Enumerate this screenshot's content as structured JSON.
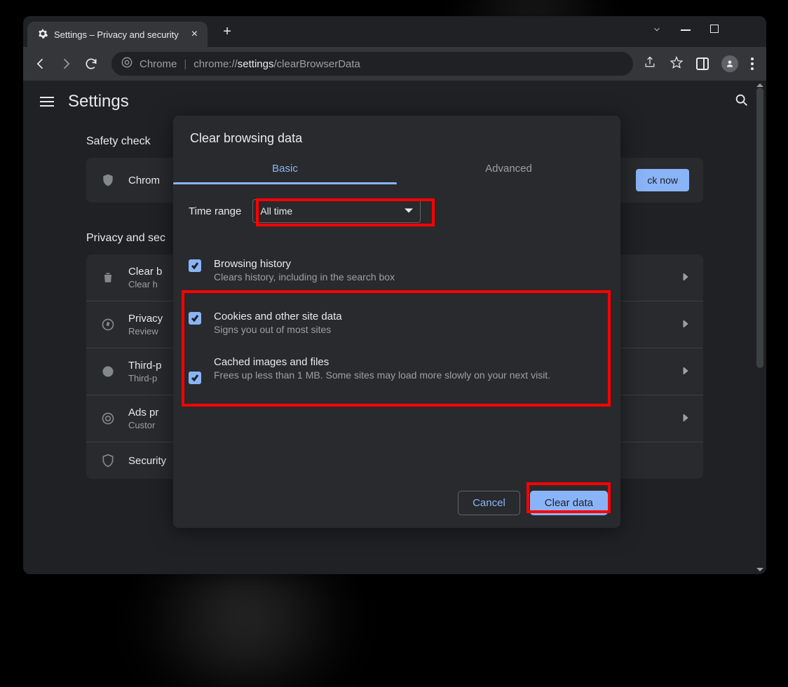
{
  "tab": {
    "title": "Settings – Privacy and security"
  },
  "omnibox": {
    "scheme_label": "Chrome",
    "url_prefix": "chrome://",
    "url_bold": "settings",
    "url_suffix": "/clearBrowserData"
  },
  "app": {
    "title": "Settings",
    "safety_check_heading": "Safety check",
    "safety_row_text": "Chrom",
    "check_now_label": "ck now",
    "privacy_heading": "Privacy and sec",
    "rows": [
      {
        "title": "Clear b",
        "sub": "Clear h"
      },
      {
        "title": "Privacy",
        "sub": "Review"
      },
      {
        "title": "Third-p",
        "sub": "Third-p"
      },
      {
        "title": "Ads pr",
        "sub": "Custor"
      },
      {
        "title": "Security",
        "sub": ""
      }
    ]
  },
  "dialog": {
    "title": "Clear browsing data",
    "tabs": {
      "basic": "Basic",
      "advanced": "Advanced"
    },
    "time_range_label": "Time range",
    "time_range_value": "All time",
    "items": [
      {
        "title": "Browsing history",
        "desc": "Clears history, including in the search box"
      },
      {
        "title": "Cookies and other site data",
        "desc": "Signs you out of most sites"
      },
      {
        "title": "Cached images and files",
        "desc": "Frees up less than 1 MB. Some sites may load more slowly on your next visit."
      }
    ],
    "cancel_label": "Cancel",
    "clear_label": "Clear data"
  }
}
